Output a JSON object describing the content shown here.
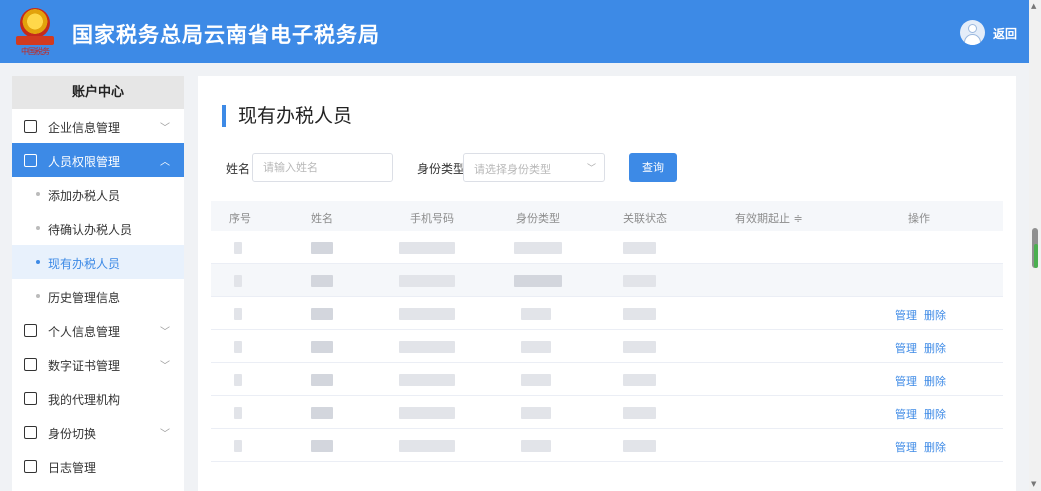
{
  "header": {
    "logo_text": "中国税务",
    "title": "国家税务总局云南省电子税务局",
    "back_label": "返回"
  },
  "sidebar": {
    "heading": "账户中心",
    "items": [
      {
        "label": "企业信息管理",
        "icon": "building-icon",
        "expanded": false
      },
      {
        "label": "人员权限管理",
        "icon": "user-key-icon",
        "expanded": true,
        "children": [
          "添加办税人员",
          "待确认办税人员",
          "现有办税人员",
          "历史管理信息"
        ],
        "active_child": "现有办税人员"
      },
      {
        "label": "个人信息管理",
        "icon": "id-card-icon",
        "expanded": false
      },
      {
        "label": "数字证书管理",
        "icon": "certificate-icon",
        "expanded": false
      },
      {
        "label": "我的代理机构",
        "icon": "agency-icon",
        "expanded": null
      },
      {
        "label": "身份切换",
        "icon": "switch-icon",
        "expanded": false
      },
      {
        "label": "日志管理",
        "icon": "log-icon",
        "expanded": null
      }
    ]
  },
  "main": {
    "page_title": "现有办税人员",
    "filters": {
      "name_label": "姓名",
      "name_placeholder": "请输入姓名",
      "type_label": "身份类型",
      "type_placeholder": "请选择身份类型",
      "query_button": "查询"
    },
    "table": {
      "columns": [
        "序号",
        "姓名",
        "手机号码",
        "身份类型",
        "关联状态",
        "有效期起止 ≑",
        "操作"
      ],
      "row_actions": [
        "管理",
        "删除"
      ],
      "rows_visible": 7,
      "rows_with_actions": [
        2,
        3,
        4,
        5,
        6
      ],
      "highlighted_row": 1
    }
  },
  "colors": {
    "brand_blue": "#3d8ae6",
    "sidebar_active_bg": "#e8f1fc",
    "table_header_bg": "#f5f7fa"
  }
}
